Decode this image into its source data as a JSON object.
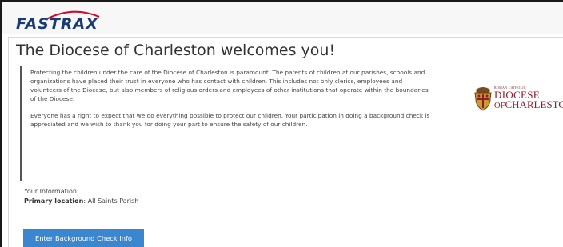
{
  "header": {
    "logo_text": "FASTRAX"
  },
  "welcome": {
    "title": "The Diocese of Charleston welcomes you!",
    "paragraph1": "Protecting the children under the care of the Diocese of Charleston is paramount. The parents of children at our parishes, schools and organizations have placed their trust in everyone who has contact with children. This includes not only clerics, employees and volunteers of the Diocese, but also members of religious orders and employees of other institutions that operate within the boundaries of the Diocese.",
    "paragraph2": "Everyone has a right to expect that we do everything possible to protect our children. Your participation in doing a background check is appreciated and we wish to thank you for doing your part to ensure the safety of our children."
  },
  "seal": {
    "small_text": "ROMAN CATHOLIC",
    "line1": "DIOCESE",
    "line2_prefix": "OF",
    "line2_main": "CHARLESTON"
  },
  "info": {
    "heading": "Your Information",
    "primary_label": "Primary location",
    "primary_value": ": All Saints Parish"
  },
  "actions": {
    "background_check_label": "Enter Background Check Info"
  },
  "colors": {
    "brand_navy": "#1a3b73",
    "accent_red": "#c8102e",
    "button_blue": "#3a87cf",
    "seal_red": "#8a1e2b"
  }
}
